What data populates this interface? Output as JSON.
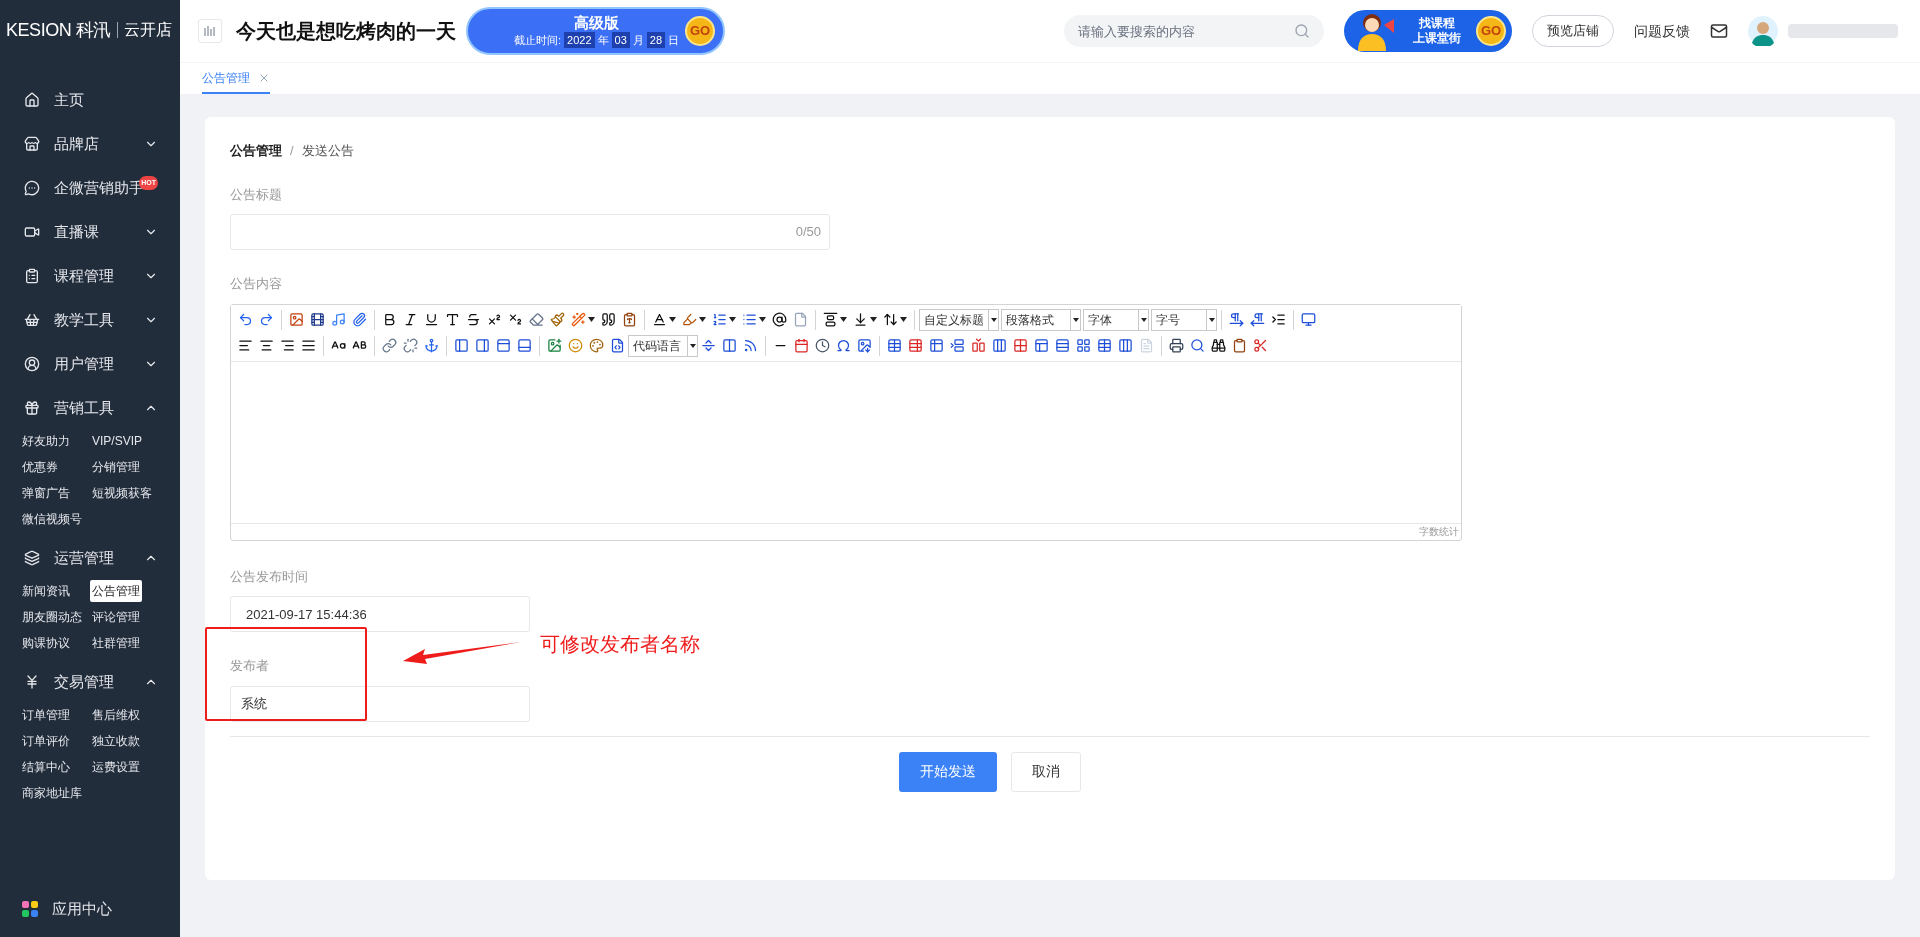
{
  "logo": {
    "brand": "KESION 科汛",
    "product": "云开店"
  },
  "header": {
    "store_title": "今天也是想吃烤肉的一天",
    "plan_banner": {
      "title": "高级版",
      "deadline_label": "截止时间:",
      "year": "2022",
      "year_unit": "年",
      "month": "03",
      "month_unit": "月",
      "day": "28",
      "day_unit": "日",
      "go": "GO"
    },
    "search": {
      "placeholder": "请输入要搜索的内容"
    },
    "course_banner": {
      "line_1": "找课程",
      "line_2": "上课堂街",
      "go": "GO"
    },
    "preview_button": "预览店铺",
    "feedback_link": "问题反馈"
  },
  "tabs": [
    {
      "label": "公告管理",
      "selected": true
    }
  ],
  "sidebar": {
    "items": [
      {
        "kind": "link",
        "label": "主页"
      },
      {
        "kind": "group",
        "label": "品牌店",
        "expanded": false
      },
      {
        "kind": "link",
        "label": "企微营销助手",
        "badge": "HOT"
      },
      {
        "kind": "group",
        "label": "直播课",
        "expanded": false
      },
      {
        "kind": "group",
        "label": "课程管理",
        "expanded": false
      },
      {
        "kind": "group",
        "label": "教学工具",
        "expanded": false
      },
      {
        "kind": "group",
        "label": "用户管理",
        "expanded": false
      },
      {
        "kind": "group",
        "label": "营销工具",
        "expanded": true,
        "children": [
          {
            "label": "好友助力",
            "selected": false
          },
          {
            "label": "VIP/SVIP",
            "selected": false
          },
          {
            "label": "优惠券",
            "selected": false
          },
          {
            "label": "分销管理",
            "selected": false
          },
          {
            "label": "弹窗广告",
            "selected": false
          },
          {
            "label": "短视频获客",
            "selected": false
          },
          {
            "label": "微信视频号",
            "selected": false
          }
        ]
      },
      {
        "kind": "group",
        "label": "运营管理",
        "expanded": true,
        "children": [
          {
            "label": "新闻资讯",
            "selected": false
          },
          {
            "label": "公告管理",
            "selected": true
          },
          {
            "label": "朋友圈动态",
            "selected": false
          },
          {
            "label": "评论管理",
            "selected": false
          },
          {
            "label": "购课协议",
            "selected": false
          },
          {
            "label": "社群管理",
            "selected": false
          }
        ]
      },
      {
        "kind": "group",
        "label": "交易管理",
        "expanded": true,
        "children": [
          {
            "label": "订单管理",
            "selected": false
          },
          {
            "label": "售后维权",
            "selected": false
          },
          {
            "label": "订单评价",
            "selected": false
          },
          {
            "label": "独立收款",
            "selected": false
          },
          {
            "label": "结算中心",
            "selected": false
          },
          {
            "label": "运费设置",
            "selected": false
          },
          {
            "label": "商家地址库",
            "selected": false
          }
        ]
      }
    ],
    "footer_item": "应用中心"
  },
  "breadcrumb": {
    "items": [
      "公告管理",
      "发送公告"
    ],
    "separator": "/"
  },
  "form": {
    "title_field": {
      "label": "公告标题",
      "counter": "0/50"
    },
    "content_field": {
      "label": "公告内容",
      "dropdowns_row_1": [
        "自定义标题",
        "段落格式",
        "字体",
        "字号"
      ],
      "dropdown_row_2": "代码语言",
      "word_count": "字数统计"
    },
    "time_field": {
      "label": "公告发布时间",
      "value": "2021-09-17 15:44:36"
    },
    "publisher_field": {
      "label": "发布者",
      "value": "系统"
    },
    "submit_button": "开始发送",
    "cancel_button": "取消"
  },
  "annotation": {
    "text": "可修改发布者名称"
  }
}
